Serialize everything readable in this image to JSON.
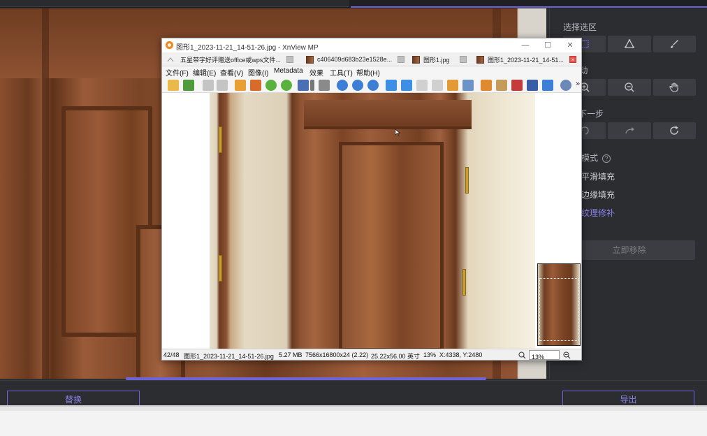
{
  "editor": {
    "right_panel": {
      "section_select": "选择选区",
      "section_move": "& 移动",
      "section_undo": "步 / 下一步",
      "section_mode": "模式",
      "mode_help": "?",
      "option_smooth": "平滑填充",
      "option_edge": "边缘填充",
      "option_texture": "纹理修补",
      "remove_button": "立即移除"
    },
    "replace_button": "替换",
    "export_button": "导出",
    "accent_color": "#6e63d9"
  },
  "xnview": {
    "title": "图形1_2023-11-21_14-51-26.jpg - XnView MP",
    "window_controls": {
      "minimize": "—",
      "maximize": "☐",
      "close": "✕"
    },
    "tabs": [
      {
        "label": "五星带字好评赠送office或wps文件..."
      },
      {
        "label": "c406409d683b23e1528e..."
      },
      {
        "label": "图形1.jpg"
      },
      {
        "label": "图形1_2023-11-21_14-51..."
      }
    ],
    "tab_close_active": "×",
    "menu": [
      "文件(F)",
      "编辑(E)",
      "查看(V)",
      "图像(I)",
      "Metadata",
      "效果",
      "工具(T)",
      "帮助(H)"
    ],
    "toolbar_overflow": "»",
    "status": {
      "index": "42/48",
      "filename": "图形1_2023-11-21_14-51-26.jpg",
      "size": "5.27 MB",
      "dimensions": "7566x16800x24 (2.22)",
      "print_size": "25.22x56.00 英寸",
      "zoom_pct": "13%",
      "coords": "X:4338, Y:2480",
      "zoom_box": "13%"
    }
  }
}
